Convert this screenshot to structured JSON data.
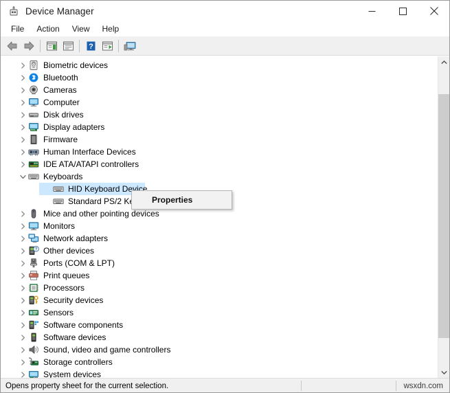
{
  "window": {
    "title": "Device Manager",
    "icon": "device-manager-icon",
    "controls": {
      "minimize": "—",
      "maximize": "□",
      "close": "✕"
    }
  },
  "menubar": {
    "items": [
      {
        "label": "File",
        "name": "menu-file"
      },
      {
        "label": "Action",
        "name": "menu-action"
      },
      {
        "label": "View",
        "name": "menu-view"
      },
      {
        "label": "Help",
        "name": "menu-help"
      }
    ]
  },
  "toolbar": {
    "buttons": [
      {
        "name": "back-button",
        "icon": "back-arrow-icon"
      },
      {
        "name": "forward-button",
        "icon": "forward-arrow-icon"
      },
      {
        "name": "show-hidden-devices-button",
        "icon": "window-list-icon"
      },
      {
        "name": "properties-button",
        "icon": "properties-sheet-icon"
      },
      {
        "name": "help-button",
        "icon": "question-mark-icon"
      },
      {
        "name": "update-driver-button",
        "icon": "window-play-icon"
      },
      {
        "name": "scan-hardware-changes-button",
        "icon": "monitor-scan-icon"
      }
    ]
  },
  "tree": {
    "items": [
      {
        "label": "Biometric devices",
        "level": 0,
        "expanded": false,
        "icon": "fingerprint-icon",
        "selected": false
      },
      {
        "label": "Bluetooth",
        "level": 0,
        "expanded": false,
        "icon": "bluetooth-icon",
        "selected": false
      },
      {
        "label": "Cameras",
        "level": 0,
        "expanded": false,
        "icon": "camera-icon",
        "selected": false
      },
      {
        "label": "Computer",
        "level": 0,
        "expanded": false,
        "icon": "computer-monitor-icon",
        "selected": false
      },
      {
        "label": "Disk drives",
        "level": 0,
        "expanded": false,
        "icon": "disk-drive-icon",
        "selected": false
      },
      {
        "label": "Display adapters",
        "level": 0,
        "expanded": false,
        "icon": "display-adapter-icon",
        "selected": false
      },
      {
        "label": "Firmware",
        "level": 0,
        "expanded": false,
        "icon": "firmware-chip-icon",
        "selected": false
      },
      {
        "label": "Human Interface Devices",
        "level": 0,
        "expanded": false,
        "icon": "hid-devices-icon",
        "selected": false
      },
      {
        "label": "IDE ATA/ATAPI controllers",
        "level": 0,
        "expanded": false,
        "icon": "ide-controller-icon",
        "selected": false
      },
      {
        "label": "Keyboards",
        "level": 0,
        "expanded": true,
        "icon": "keyboard-icon",
        "selected": false
      },
      {
        "label": "HID Keyboard Device",
        "level": 1,
        "expanded": null,
        "icon": "keyboard-icon",
        "selected": true
      },
      {
        "label": "Standard PS/2 Keyboard",
        "level": 1,
        "expanded": null,
        "icon": "keyboard-icon",
        "selected": false
      },
      {
        "label": "Mice and other pointing devices",
        "level": 0,
        "expanded": false,
        "icon": "mouse-icon",
        "selected": false
      },
      {
        "label": "Monitors",
        "level": 0,
        "expanded": false,
        "icon": "monitor-icon",
        "selected": false
      },
      {
        "label": "Network adapters",
        "level": 0,
        "expanded": false,
        "icon": "network-adapter-icon",
        "selected": false
      },
      {
        "label": "Other devices",
        "level": 0,
        "expanded": false,
        "icon": "unknown-device-icon",
        "selected": false
      },
      {
        "label": "Ports (COM & LPT)",
        "level": 0,
        "expanded": false,
        "icon": "port-icon",
        "selected": false
      },
      {
        "label": "Print queues",
        "level": 0,
        "expanded": false,
        "icon": "printer-icon",
        "selected": false
      },
      {
        "label": "Processors",
        "level": 0,
        "expanded": false,
        "icon": "processor-icon",
        "selected": false
      },
      {
        "label": "Security devices",
        "level": 0,
        "expanded": false,
        "icon": "security-key-icon",
        "selected": false
      },
      {
        "label": "Sensors",
        "level": 0,
        "expanded": false,
        "icon": "sensor-icon",
        "selected": false
      },
      {
        "label": "Software components",
        "level": 0,
        "expanded": false,
        "icon": "software-component-icon",
        "selected": false
      },
      {
        "label": "Software devices",
        "level": 0,
        "expanded": false,
        "icon": "software-device-icon",
        "selected": false
      },
      {
        "label": "Sound, video and game controllers",
        "level": 0,
        "expanded": false,
        "icon": "speaker-icon",
        "selected": false
      },
      {
        "label": "Storage controllers",
        "level": 0,
        "expanded": false,
        "icon": "storage-controller-icon",
        "selected": false
      },
      {
        "label": "System devices",
        "level": 0,
        "expanded": false,
        "icon": "system-device-icon",
        "selected": false
      }
    ]
  },
  "context_menu": {
    "items": [
      {
        "label": "Properties",
        "name": "context-menu-properties",
        "bold": true
      }
    ]
  },
  "statusbar": {
    "message": "Opens property sheet for the current selection.",
    "watermark": "wsxdn.com"
  },
  "colors": {
    "selection": "#cce8ff",
    "toolbar_bg": "#f0f0f0",
    "statusbar_bg": "#f0f0f0",
    "scrollbar_thumb": "#cdcdcd",
    "accent_blue": "#0078d7"
  }
}
